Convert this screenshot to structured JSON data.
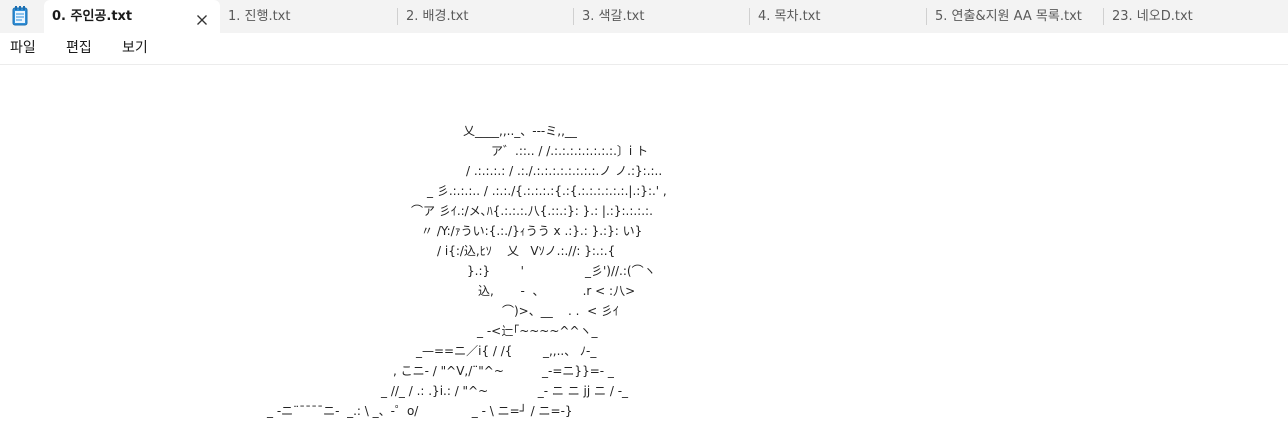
{
  "app": {
    "icon": "notepad-icon"
  },
  "tabs": [
    {
      "label": "0. 주인공.txt",
      "active": true
    },
    {
      "label": "1. 진행.txt",
      "active": false
    },
    {
      "label": "2. 배경.txt",
      "active": false
    },
    {
      "label": "3. 색갈.txt",
      "active": false
    },
    {
      "label": "4. 목차.txt",
      "active": false
    },
    {
      "label": "5. 연출&지원 AA 목록.txt",
      "active": false
    },
    {
      "label": "23. 네오D.txt",
      "active": false
    }
  ],
  "menu": {
    "file": "파일",
    "edit": "편집",
    "view": "보기"
  },
  "editor": {
    "lines": [
      "乂____,,.._、---ミ,,__",
      "ア゛.::.. / /.:.:.:.:.:.:.:.:.〕i ト",
      "/ .:.:.:.: / .:./.:.:.:.:.:.:.:.:.ノ ノ.:}:.:..",
      "_ 彡.:.:.:.. / .:.:./{.:.:.:.:{.:{.:.:.:.:.:.:.|.:}:.' ,",
      "⌒ア 彡ｲ.:/メ､ﾊ{.:.:.:.八{.::.:}: }.: |.:}:.:.:.:.",
      "〃 /Y:/ｧうい:{.:./}ｨうう x .:}.: }.:}: い}",
      "/ i{:/込,ﾋｿ    乂   Vｿノ.:.//: }:.:.{",
      "}.:}        '                _彡')//.:(⌒ヽ",
      "込,       -  、          .r < :八>",
      "⌒)>、__    . .  < 彡ｲ",
      "_ -<辷｢~~~~^^ヽ_",
      "_—==ニ／i{ / /{        _,,..、 ﾉ-_",
      ", こニ- / \"^V,/¨\"^~          _-=ニ}}=- _",
      "_ //_ / .: .}i.: / \"^~             _- ニ ニ jj ニ / -_",
      "_ -ニ¨¯¯¯¯ニ-  _.: \\ _、-゜o/              _ - \\ ニ=┘ / ニ=-}"
    ]
  }
}
